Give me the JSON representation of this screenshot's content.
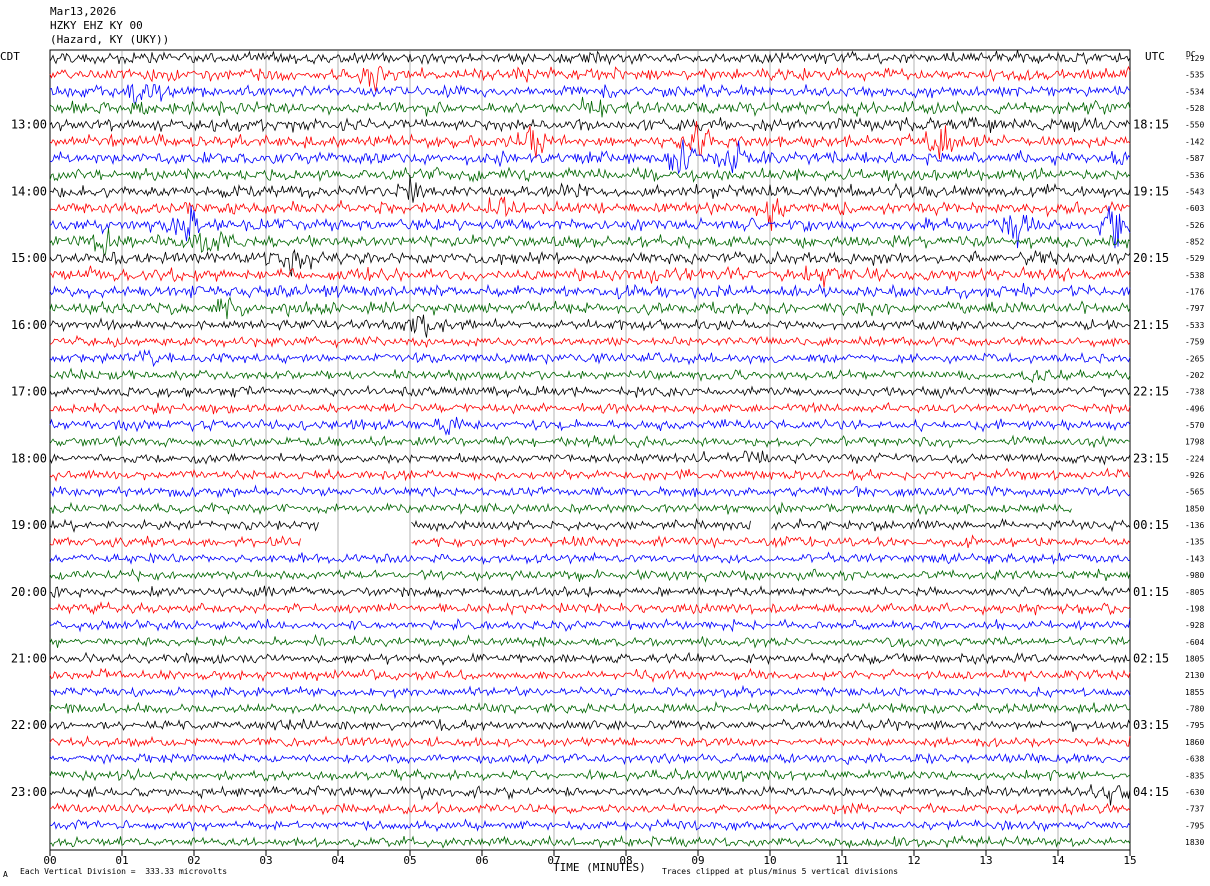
{
  "header": {
    "date": "Mar13,2026",
    "station": "HZKY EHZ KY 00",
    "location": "(Hazard, KY (UKY))"
  },
  "left_tz": "CDT",
  "right_tz": "UTC",
  "dc_label": "DC",
  "footer": {
    "scale_note": "Each Vertical Division =  333.33 microvolts",
    "clip_note": "Traces clipped at plus/minus 5 vertical divisions",
    "corner_mark": "A"
  },
  "chart_data": {
    "type": "line",
    "title": "",
    "xlabel": "TIME (MINUTES)",
    "xlim": [
      0,
      15
    ],
    "x_ticks": [
      "00",
      "01",
      "02",
      "03",
      "04",
      "05",
      "06",
      "07",
      "08",
      "09",
      "10",
      "11",
      "12",
      "13",
      "14",
      "15"
    ],
    "left_hour_labels": [
      "13:00",
      "14:00",
      "15:00",
      "16:00",
      "17:00",
      "18:00",
      "19:00",
      "20:00",
      "21:00",
      "22:00",
      "23:00"
    ],
    "right_hour_labels": [
      "18:15",
      "19:15",
      "20:15",
      "21:15",
      "22:15",
      "23:15",
      "00:15",
      "01:15",
      "02:15",
      "03:15",
      "04:15"
    ],
    "trace_color_cycle": [
      "#000000",
      "#ff0000",
      "#0000ff",
      "#006600"
    ],
    "trace_count": 48,
    "dc_offsets": [
      "-129",
      "-535",
      "-534",
      "-528",
      "-550",
      "-142",
      "-587",
      "-536",
      "-543",
      "-603",
      "-526",
      "-852",
      "-529",
      "-538",
      "-176",
      "-797",
      "-533",
      "-759",
      "-265",
      "-202",
      "-738",
      "-496",
      "-570",
      "1798",
      "-224",
      "-926",
      "-565",
      "1850",
      "-136",
      "-135",
      "-143",
      "-980",
      "-805",
      "-198",
      "-928",
      "-604",
      "1805",
      "2130",
      "1855",
      "-780",
      "-795",
      "1860",
      "-638",
      "-835",
      "-630",
      "-737",
      "-795",
      "1830"
    ],
    "data_gaps": [
      {
        "trace": 27,
        "from_min": 14.2,
        "to_min": 15.0
      },
      {
        "trace": 28,
        "from_min": 3.75,
        "to_min": 5.0
      },
      {
        "trace": 28,
        "from_min": 9.75,
        "to_min": 10.0
      },
      {
        "trace": 29,
        "from_min": 3.5,
        "to_min": 5.0
      }
    ],
    "events": [
      {
        "trace": 1,
        "minute": 4.5,
        "amp": 3.0
      },
      {
        "trace": 2,
        "minute": 1.3,
        "amp": 3.5
      },
      {
        "trace": 3,
        "minute": 7.5,
        "amp": 2.5
      },
      {
        "trace": 5,
        "minute": 6.7,
        "amp": 4.0
      },
      {
        "trace": 5,
        "minute": 9.0,
        "amp": 3.5
      },
      {
        "trace": 5,
        "minute": 12.4,
        "amp": 4.5
      },
      {
        "trace": 6,
        "minute": 8.8,
        "amp": 4.0
      },
      {
        "trace": 6,
        "minute": 9.5,
        "amp": 2.5
      },
      {
        "trace": 8,
        "minute": 5.0,
        "amp": 2.5
      },
      {
        "trace": 9,
        "minute": 6.2,
        "amp": 4.0
      },
      {
        "trace": 9,
        "minute": 10.0,
        "amp": 3.0
      },
      {
        "trace": 10,
        "minute": 1.9,
        "amp": 5.0
      },
      {
        "trace": 10,
        "minute": 13.4,
        "amp": 3.5
      },
      {
        "trace": 10,
        "minute": 14.8,
        "amp": 5.0
      },
      {
        "trace": 11,
        "minute": 0.8,
        "amp": 3.5
      },
      {
        "trace": 11,
        "minute": 2.2,
        "amp": 4.0
      },
      {
        "trace": 12,
        "minute": 3.4,
        "amp": 2.5
      },
      {
        "trace": 13,
        "minute": 10.7,
        "amp": 2.0
      },
      {
        "trace": 15,
        "minute": 2.5,
        "amp": 2.0
      },
      {
        "trace": 16,
        "minute": 5.2,
        "amp": 3.5
      },
      {
        "trace": 18,
        "minute": 1.4,
        "amp": 2.0
      },
      {
        "trace": 19,
        "minute": 13.7,
        "amp": 2.5
      },
      {
        "trace": 22,
        "minute": 5.6,
        "amp": 2.5
      },
      {
        "trace": 24,
        "minute": 9.8,
        "amp": 2.0
      },
      {
        "trace": 44,
        "minute": 14.7,
        "amp": 2.5
      }
    ]
  }
}
